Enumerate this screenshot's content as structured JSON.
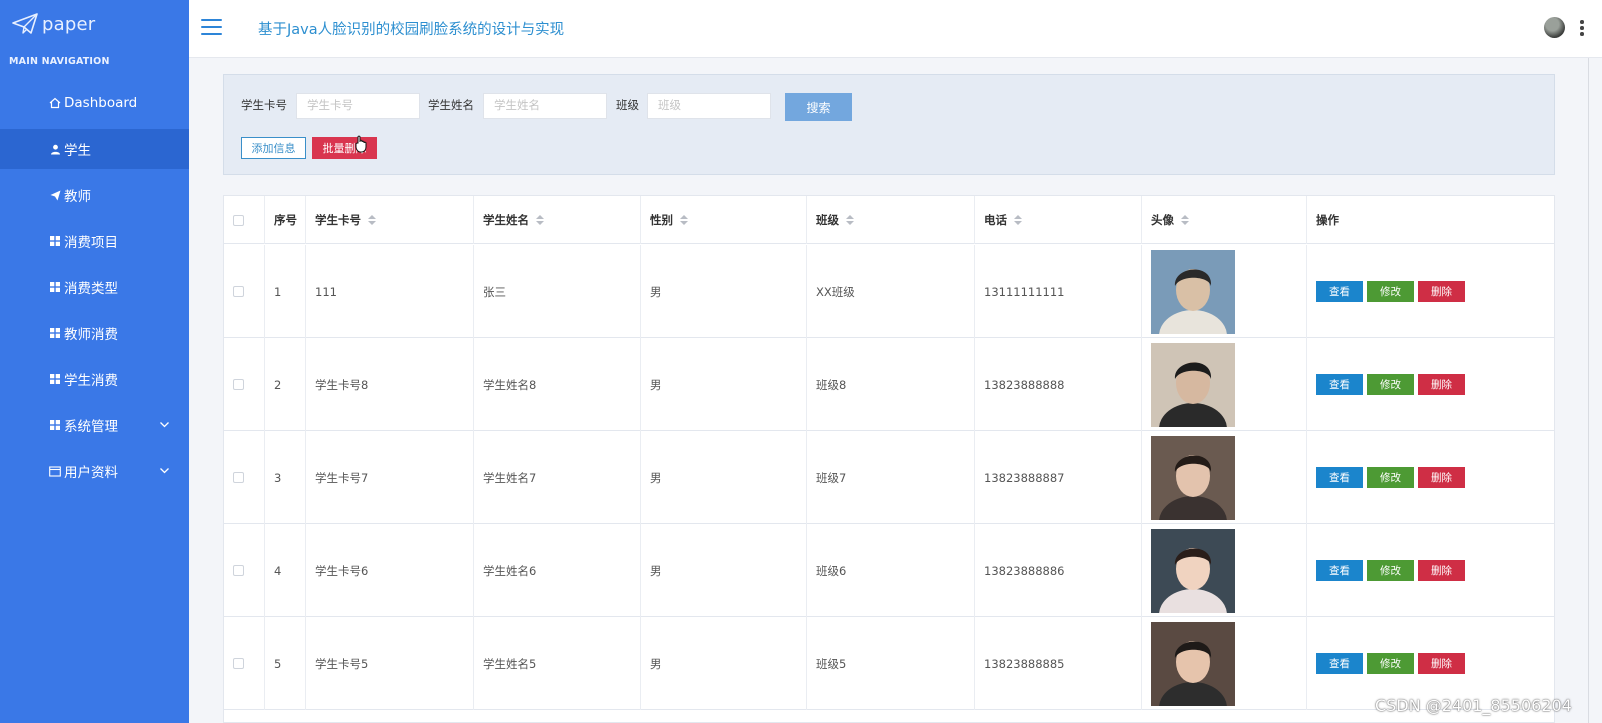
{
  "app": {
    "logo_text": "paper",
    "title": "基于Java人脸识别的校园刷脸系统的设计与实现"
  },
  "sidebar": {
    "heading": "MAIN NAVIGATION",
    "items": [
      {
        "label": "Dashboard",
        "icon": "home-icon"
      },
      {
        "label": "学生",
        "icon": "user-icon",
        "active": true
      },
      {
        "label": "教师",
        "icon": "paper-plane-icon"
      },
      {
        "label": "消费项目",
        "icon": "grid-icon"
      },
      {
        "label": "消费类型",
        "icon": "grid-icon"
      },
      {
        "label": "教师消费",
        "icon": "grid-icon"
      },
      {
        "label": "学生消费",
        "icon": "grid-icon"
      },
      {
        "label": "系统管理",
        "icon": "grid-icon",
        "expandable": true
      },
      {
        "label": "用户资料",
        "icon": "card-icon",
        "expandable": true
      }
    ]
  },
  "search": {
    "card_label": "学生卡号",
    "card_placeholder": "学生卡号",
    "name_label": "学生姓名",
    "name_placeholder": "学生姓名",
    "class_label": "班级",
    "class_placeholder": "班级",
    "search_button": "搜索",
    "add_button": "添加信息",
    "batch_button": "批量删除"
  },
  "table": {
    "columns": [
      "序号",
      "学生卡号",
      "学生姓名",
      "性别",
      "班级",
      "电话",
      "头像",
      "操作"
    ],
    "rows": [
      {
        "index": "1",
        "card": "111",
        "name": "张三",
        "gender": "男",
        "class": "XX班级",
        "phone": "13111111111"
      },
      {
        "index": "2",
        "card": "学生卡号8",
        "name": "学生姓名8",
        "gender": "男",
        "class": "班级8",
        "phone": "13823888888"
      },
      {
        "index": "3",
        "card": "学生卡号7",
        "name": "学生姓名7",
        "gender": "男",
        "class": "班级7",
        "phone": "13823888887"
      },
      {
        "index": "4",
        "card": "学生卡号6",
        "name": "学生姓名6",
        "gender": "男",
        "class": "班级6",
        "phone": "13823888886"
      },
      {
        "index": "5",
        "card": "学生卡号5",
        "name": "学生姓名5",
        "gender": "男",
        "class": "班级5",
        "phone": "13823888885"
      }
    ],
    "actions": {
      "view": "查看",
      "edit": "修改",
      "delete": "删除"
    }
  },
  "watermark": "CSDN @2401_85506204",
  "colors": {
    "sidebar": "#3a78e7",
    "sidebar_active": "#2b66d1",
    "title": "#2d8fd0",
    "view_button": "#1b85cc",
    "edit_button": "#4d9a34",
    "delete_button": "#cf2e45"
  }
}
